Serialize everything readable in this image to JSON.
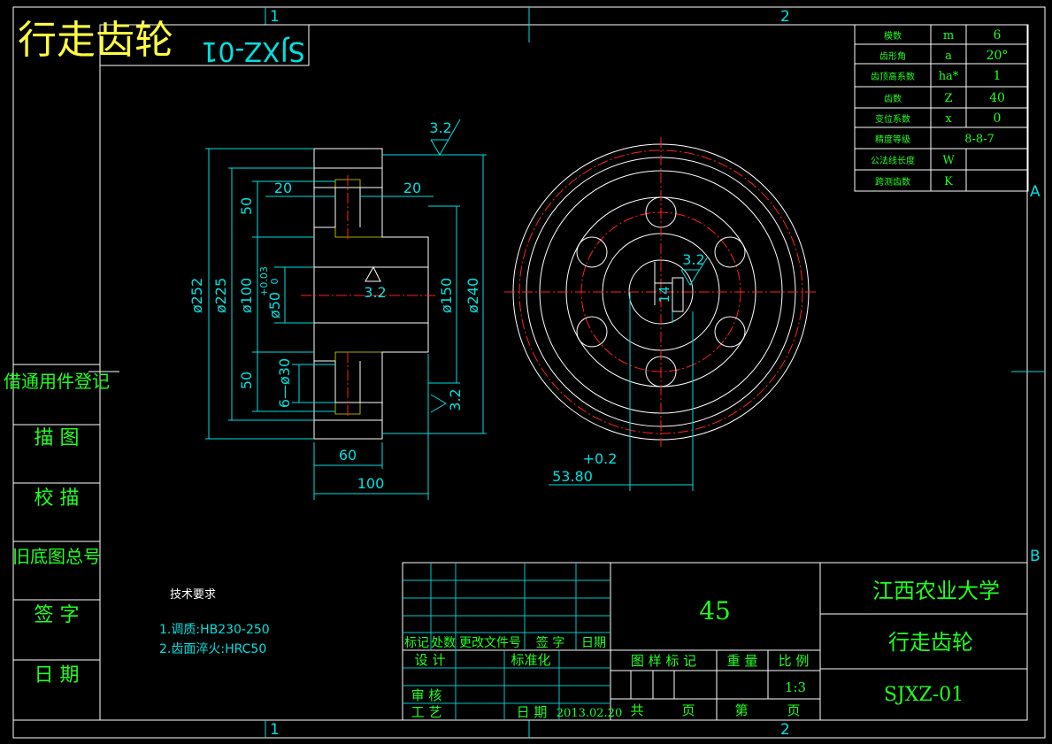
{
  "overlay_title": "行走齿轮",
  "mirrored_code": "SJXZ-01",
  "zone_labels": {
    "col1": "1",
    "col2": "2",
    "rowA": "A",
    "rowB": "B"
  },
  "side_panel": [
    "借通用件登记",
    "描 图",
    "校 描",
    "旧底图总号",
    "签 字",
    "日 期"
  ],
  "params": [
    {
      "label": "模数",
      "sym": "m",
      "val": "6"
    },
    {
      "label": "齿形角",
      "sym": "a",
      "val": "20°"
    },
    {
      "label": "齿顶高系数",
      "sym": "ha*",
      "val": "1"
    },
    {
      "label": "齿数",
      "sym": "Z",
      "val": "40"
    },
    {
      "label": "变位系数",
      "sym": "x",
      "val": "0"
    },
    {
      "label": "精度等级",
      "sym": "",
      "val": "8-8-7"
    },
    {
      "label": "公法线长度",
      "sym": "W",
      "val": ""
    },
    {
      "label": "跨测齿数",
      "sym": "K",
      "val": ""
    }
  ],
  "dims": {
    "d252": "ø252",
    "d225": "ø225",
    "d100": "ø100",
    "d50": "ø50",
    "tol_upper": "+0.03",
    "tol_lower": "0",
    "d150": "ø150",
    "d240": "ø240",
    "d30": "6—ø30",
    "w20a": "20",
    "w20b": "20",
    "h50a": "50",
    "h50b": "50",
    "l60": "60",
    "l100": "100",
    "rough1": "3.2",
    "rough2": "3.2",
    "rough3": "3.2",
    "rough4": "3.2",
    "key_w": "14",
    "key_tol": "+0.2",
    "key_depth": "53.80"
  },
  "tech": {
    "title": "技术要求",
    "line1": "1.调质:HB230-250",
    "line2": "2.齿面淬火:HRC50"
  },
  "title_block": {
    "material": "45",
    "school": "江西农业大学",
    "part_name": "行走齿轮",
    "drawing_no": "SJXZ-01",
    "rev_headers": [
      "标记",
      "处数",
      "更改文件号",
      "签 字",
      "日期"
    ],
    "design": "设 计",
    "standard": "标准化",
    "review": "审 核",
    "process": "工 艺",
    "date_label": "日 期",
    "date_value": "2013.02.20",
    "hdr_mark": "图 样 标 记",
    "hdr_weight": "重 量",
    "hdr_scale": "比 例",
    "scale": "1:3",
    "total": "共",
    "page1": "页",
    "sheet": "第",
    "page2": "页"
  }
}
